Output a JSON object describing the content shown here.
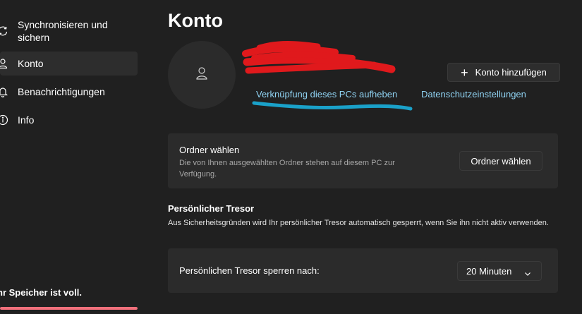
{
  "sidebar": {
    "items": [
      {
        "label": "Synchronisieren und\nsichern",
        "icon": "sync-icon"
      },
      {
        "label": "Konto",
        "icon": "person-icon",
        "active": true
      },
      {
        "label": "Benachrichtigungen",
        "icon": "bell-icon"
      },
      {
        "label": "Info",
        "icon": "info-icon"
      }
    ],
    "storage_warning": "hr Speicher ist voll.",
    "storage_fraction": 1.0,
    "storage_color": "#f1707b"
  },
  "page": {
    "title": "Konto"
  },
  "account": {
    "avatar_icon": "person-icon",
    "unlink_label": "Verknüpfung dieses PCs aufheben",
    "privacy_label": "Datenschutzeinstellungen",
    "add_account_label": "Konto hinzufügen",
    "add_icon": "plus-icon",
    "link_color": "#8fd2f2"
  },
  "folder_card": {
    "title": "Ordner wählen",
    "description": "Die von Ihnen ausgewählten Ordner stehen auf diesem PC zur Verfügung.",
    "button_label": "Ordner wählen"
  },
  "vault": {
    "heading": "Persönlicher Tresor",
    "description": "Aus Sicherheitsgründen wird Ihr persönlicher Tresor automatisch gesperrt, wenn Sie ihn nicht aktiv verwenden.",
    "lock_label": "Persönlichen Tresor sperren nach:",
    "lock_value": "20 Minuten"
  }
}
